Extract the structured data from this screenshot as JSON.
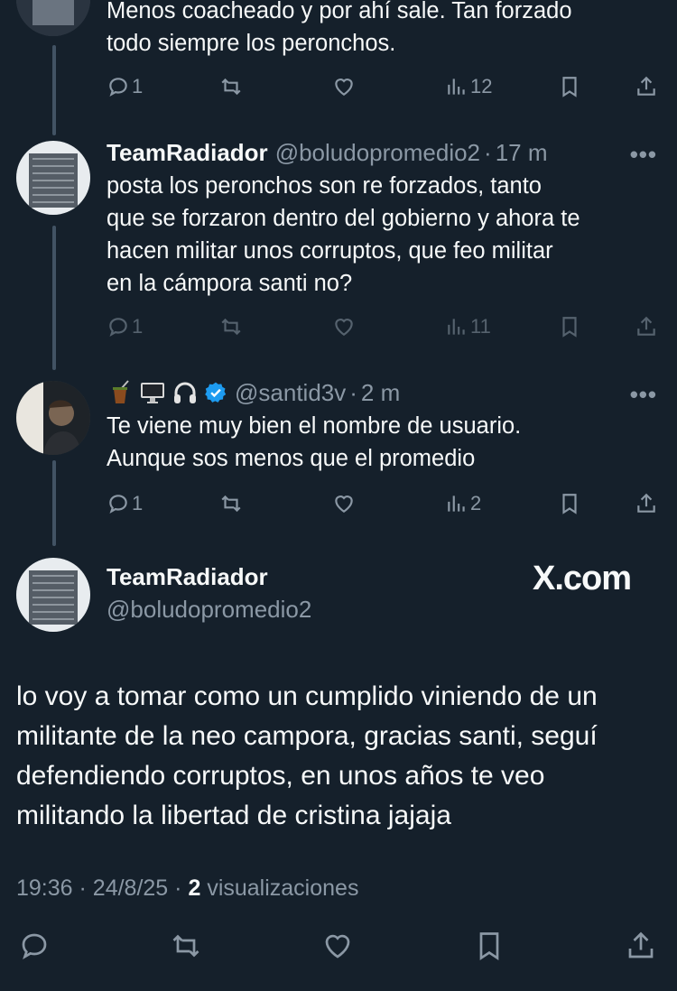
{
  "tweet0": {
    "text_lines": [
      "Menos coacheado y por ahí sale. Tan forzado",
      "todo siempre los peronchos."
    ],
    "replies": "1",
    "views": "12"
  },
  "tweet1": {
    "name": "TeamRadiador",
    "handle": "@boludopromedio2",
    "time": "17 m",
    "text_lines": [
      "posta los peronchos son re forzados, tanto",
      "que se forzaron dentro del gobierno y ahora te",
      "hacen militar unos corruptos, que feo militar",
      "en la cámpora santi no?"
    ],
    "replies": "1",
    "views": "11"
  },
  "tweet2": {
    "handle": "@santid3v",
    "time": "2 m",
    "text_lines": [
      "Te viene muy bien el nombre de usuario.",
      "Aunque sos menos que el promedio"
    ],
    "replies": "1",
    "views": "2",
    "name_emojis": [
      "mate-emoji",
      "computer-emoji",
      "headphones-emoji"
    ]
  },
  "main": {
    "name": "TeamRadiador",
    "handle": "@boludopromedio2",
    "watermark": "X.com",
    "text_lines": [
      "lo voy a tomar como un cumplido viniendo de un",
      "militante de la neo campora, gracias santi, seguí",
      "defendiendo corruptos, en unos años te veo",
      "militando la libertad de cristina jajaja"
    ],
    "time": "19:36",
    "date": "24/8/25",
    "views_count": "2",
    "views_label": "visualizaciones"
  },
  "more_glyph": "•••",
  "sep": "·",
  "colors": {
    "background": "#15202b",
    "muted": "#8b98a5",
    "text": "#f7f9f9",
    "verified": "#1d9bf0"
  }
}
